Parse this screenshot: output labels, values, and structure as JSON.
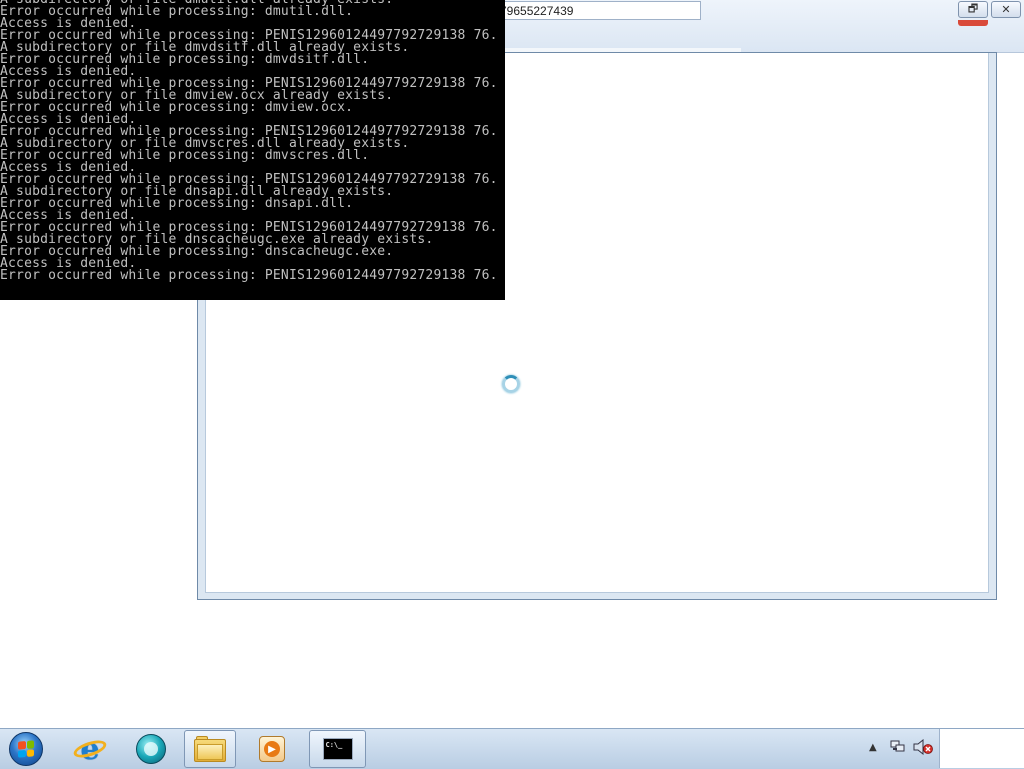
{
  "background_window": {
    "address_value": "79655227439",
    "restore_label": "🗗",
    "close_label": "✕"
  },
  "console": {
    "lines": [
      "A subdirectory or file dmutil.dll already exists.",
      "Error occurred while processing: dmutil.dll.",
      "Access is denied.",
      "Error occurred while processing: PENIS12960124497792729138 76.",
      "A subdirectory or file dmvdsitf.dll already exists.",
      "Error occurred while processing: dmvdsitf.dll.",
      "Access is denied.",
      "Error occurred while processing: PENIS12960124497792729138 76.",
      "A subdirectory or file dmview.ocx already exists.",
      "Error occurred while processing: dmview.ocx.",
      "Access is denied.",
      "Error occurred while processing: PENIS12960124497792729138 76.",
      "A subdirectory or file dmvscres.dll already exists.",
      "Error occurred while processing: dmvscres.dll.",
      "Access is denied.",
      "Error occurred while processing: PENIS12960124497792729138 76.",
      "A subdirectory or file dnsapi.dll already exists.",
      "Error occurred while processing: dnsapi.dll.",
      "Access is denied.",
      "Error occurred while processing: PENIS12960124497792729138 76.",
      "A subdirectory or file dnscacheugc.exe already exists.",
      "Error occurred while processing: dnscacheugc.exe.",
      "Access is denied.",
      "Error occurred while processing: PENIS12960124497792729138 76."
    ]
  },
  "taskbar": {
    "cmd_icon_text": "C:\\_",
    "items": [
      {
        "name": "internet-explorer",
        "icon": "ie-icon",
        "active": false
      },
      {
        "name": "windows-media-player",
        "icon": "wmp-icon",
        "active": false
      },
      {
        "name": "windows-explorer",
        "icon": "folder-icon",
        "active": true
      },
      {
        "name": "media-center",
        "icon": "media-icon",
        "active": false
      },
      {
        "name": "command-prompt",
        "icon": "cmd-icon",
        "active": true
      }
    ],
    "tray": {
      "chevron": "▲",
      "network_icon": "network-icon",
      "volume_icon": "volume-muted-icon"
    }
  },
  "colors": {
    "console_bg": "#000000",
    "console_text": "#c0c0c0",
    "taskbar": "#c8d9ec",
    "window_frame": "#dce7f2"
  }
}
